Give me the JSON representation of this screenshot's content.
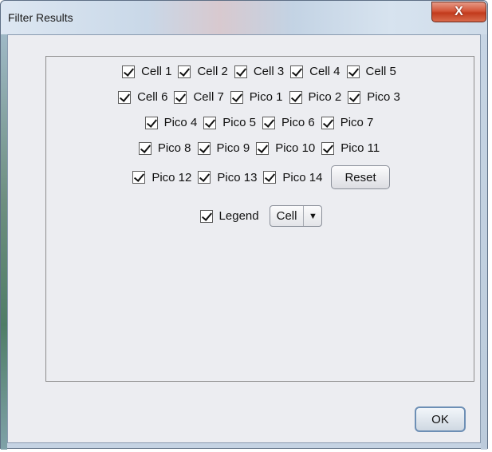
{
  "window": {
    "title": "Filter Results",
    "close_glyph": "X"
  },
  "filters": {
    "rows": [
      [
        {
          "label": "Cell 1",
          "checked": true
        },
        {
          "label": "Cell 2",
          "checked": true
        },
        {
          "label": "Cell 3",
          "checked": true
        },
        {
          "label": "Cell 4",
          "checked": true
        },
        {
          "label": "Cell 5",
          "checked": true
        }
      ],
      [
        {
          "label": "Cell 6",
          "checked": true
        },
        {
          "label": "Cell 7",
          "checked": true
        },
        {
          "label": "Pico 1",
          "checked": true
        },
        {
          "label": "Pico 2",
          "checked": true
        },
        {
          "label": "Pico 3",
          "checked": true
        }
      ],
      [
        {
          "label": "Pico 4",
          "checked": true
        },
        {
          "label": "Pico 5",
          "checked": true
        },
        {
          "label": "Pico 6",
          "checked": true
        },
        {
          "label": "Pico 7",
          "checked": true
        }
      ],
      [
        {
          "label": "Pico 8",
          "checked": true
        },
        {
          "label": "Pico 9",
          "checked": true
        },
        {
          "label": "Pico 10",
          "checked": true
        },
        {
          "label": "Pico 11",
          "checked": true
        }
      ],
      [
        {
          "label": "Pico 12",
          "checked": true
        },
        {
          "label": "Pico 13",
          "checked": true
        },
        {
          "label": "Pico 14",
          "checked": true
        }
      ]
    ],
    "reset_label": "Reset"
  },
  "legend": {
    "label": "Legend",
    "checked": true,
    "selected": "Cell"
  },
  "footer": {
    "ok_label": "OK"
  }
}
